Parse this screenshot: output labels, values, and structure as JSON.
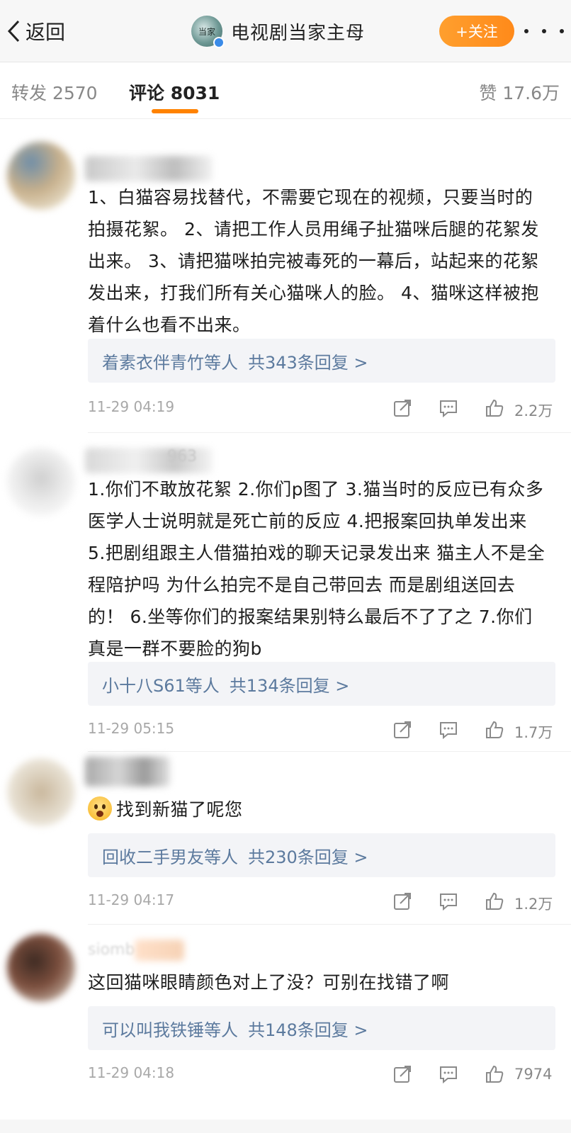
{
  "nav": {
    "back_label": "返回",
    "title": "电视剧当家主母",
    "follow_label": "+关注",
    "more_icon": "more-dots-icon",
    "avatar_text": "当家"
  },
  "tabs": {
    "repost": "转发 2570",
    "comment": "评论 8031",
    "like": "赞 17.6万",
    "accent_color": "#ff8200"
  },
  "comments": [
    {
      "text": "1、白猫容易找替代，不需要它现在的视频，只要当时的拍摄花絮。  2、请把工作人员用绳子扯猫咪后腿的花絮发出来。  3、请把猫咪拍完被毒死的一幕后，站起来的花絮发出来，打我们所有关心猫咪人的脸。  4、猫咪这样被抱着什么也看不出来。",
      "reply_users": "着素衣伴青竹等人",
      "reply_count": "共343条回复 >",
      "time": "11-29 04:19",
      "likes": "2.2万"
    },
    {
      "name_fragment": "963",
      "text": "1.你们不敢放花絮 2.你们p图了 3.猫当时的反应已有众多医学人士说明就是死亡前的反应 4.把报案回执单发出来 5.把剧组跟主人借猫拍戏的聊天记录发出来 猫主人不是全程陪护吗 为什么拍完不是自己带回去 而是剧组送回去的！ 6.坐等你们的报案结果别特么最后不了了之  7.你们真是一群不要脸的狗b",
      "reply_users": "小十八S61等人",
      "reply_count": "共134条回复 >",
      "time": "11-29 05:15",
      "likes": "1.7万"
    },
    {
      "text": "找到新猫了呢您",
      "emoji": "fearful-face-emoji",
      "reply_users": "回收二手男友等人",
      "reply_count": "共230条回复 >",
      "time": "11-29 04:17",
      "likes": "1.2万"
    },
    {
      "name_fragment": "siomb",
      "text": "这回猫咪眼睛颜色对上了没？可别在找错了啊",
      "reply_users": "可以叫我铁锤等人",
      "reply_count": "共148条回复 >",
      "time": "11-29 04:18",
      "likes": "7974"
    }
  ]
}
